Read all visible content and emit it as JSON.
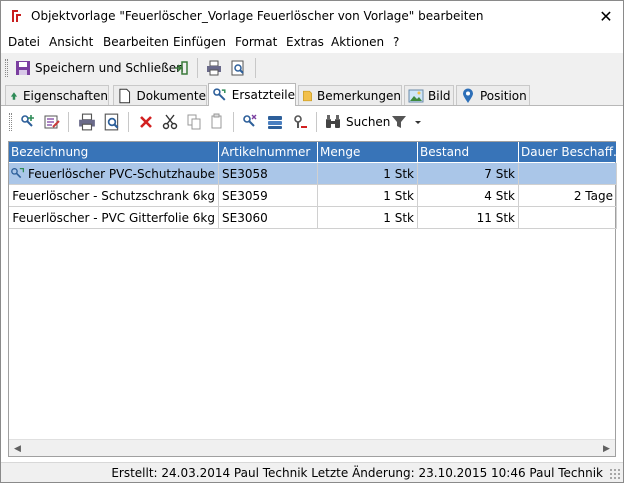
{
  "window": {
    "title": "Objektvorlage \"Feuerlöscher_Vorlage Feuerlöscher von Vorlage\" bearbeiten",
    "close_glyph": "✕"
  },
  "menu": [
    "Datei",
    "Ansicht",
    "Bearbeiten",
    "Einfügen",
    "Format",
    "Extras",
    "Aktionen",
    "?"
  ],
  "toolbar": {
    "save_close_label": "Speichern und Schließen"
  },
  "tabs": [
    {
      "label": "Eigenschaften",
      "icon": "tree-icon"
    },
    {
      "label": "Dokumente",
      "icon": "document-icon"
    },
    {
      "label": "Ersatzteile",
      "icon": "spare-parts-icon",
      "active": true
    },
    {
      "label": "Bemerkungen",
      "icon": "note-icon"
    },
    {
      "label": "Bild",
      "icon": "image-icon"
    },
    {
      "label": "Position",
      "icon": "location-pin-icon"
    }
  ],
  "parts_toolbar": {
    "search_label": "Suchen"
  },
  "grid": {
    "columns": [
      "Bezeichnung",
      "Artikelnummer",
      "Menge",
      "Bestand",
      "Dauer Beschaff..."
    ],
    "rows": [
      {
        "name": "Feuerlöscher PVC-Schutzhaube",
        "article": "SE3058",
        "quantity": "1 Stk",
        "stock": "7 Stk",
        "duration": "",
        "selected": true
      },
      {
        "name": "Feuerlöscher - Schutzschrank 6kg",
        "article": "SE3059",
        "quantity": "1 Stk",
        "stock": "4 Stk",
        "duration": "2 Tage",
        "selected": false
      },
      {
        "name": "Feuerlöscher - PVC Gitterfolie 6kg",
        "article": "SE3060",
        "quantity": "1 Stk",
        "stock": "11 Stk",
        "duration": "",
        "selected": false
      }
    ]
  },
  "status": {
    "text": "Erstellt: 24.03.2014 Paul Technik  Letzte Änderung: 23.10.2015 10:46 Paul Technik"
  },
  "colors": {
    "header_blue": "#3874b8",
    "selection_blue": "#aac6e8",
    "delete_red": "#d22020"
  }
}
